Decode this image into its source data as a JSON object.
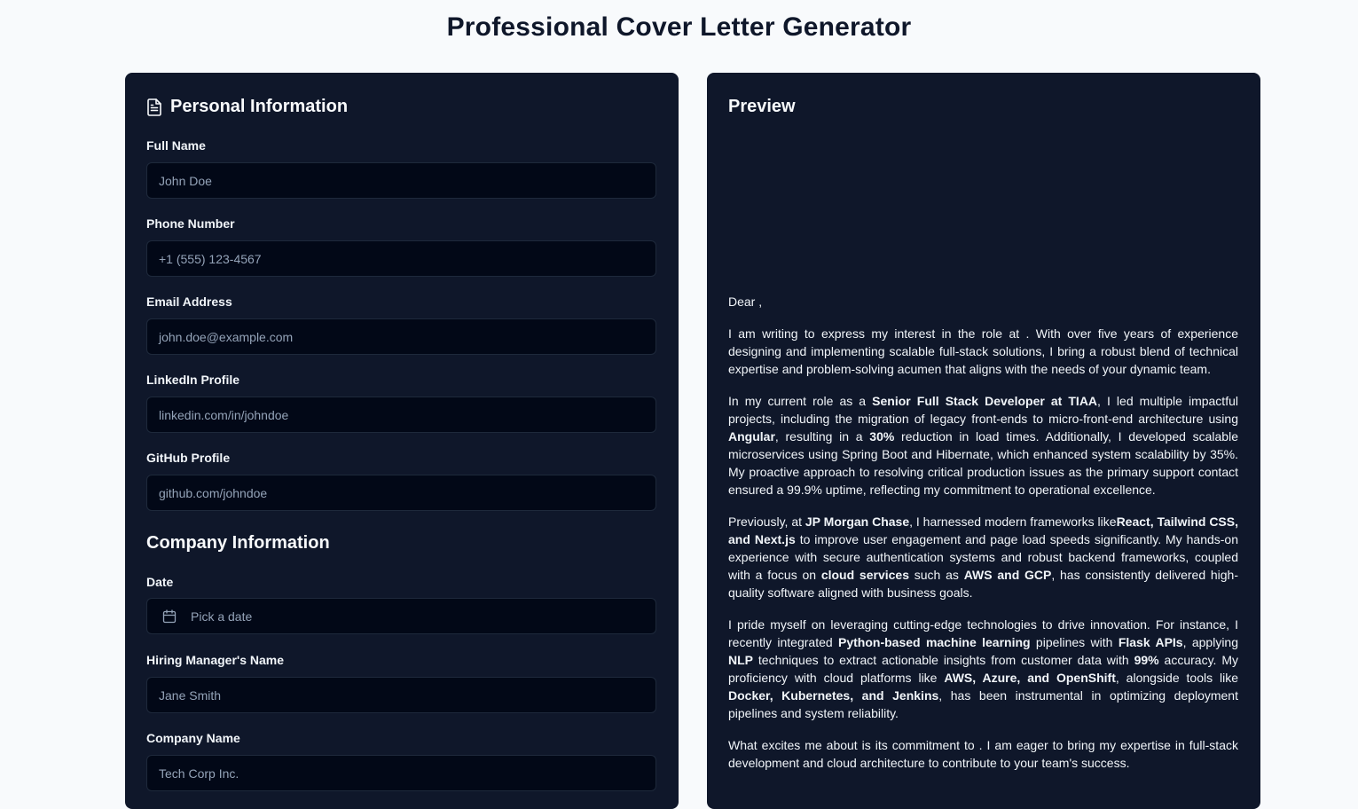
{
  "page": {
    "title": "Professional Cover Letter Generator"
  },
  "personal": {
    "title": "Personal Information",
    "full_name": {
      "label": "Full Name",
      "placeholder": "John Doe"
    },
    "phone": {
      "label": "Phone Number",
      "placeholder": "+1 (555) 123-4567"
    },
    "email": {
      "label": "Email Address",
      "placeholder": "john.doe@example.com"
    },
    "linkedin": {
      "label": "LinkedIn Profile",
      "placeholder": "linkedin.com/in/johndoe"
    },
    "github": {
      "label": "GitHub Profile",
      "placeholder": "github.com/johndoe"
    }
  },
  "company": {
    "title": "Company Information",
    "date": {
      "label": "Date",
      "placeholder": "Pick a date"
    },
    "manager": {
      "label": "Hiring Manager's Name",
      "placeholder": "Jane Smith"
    },
    "company_name": {
      "label": "Company Name",
      "placeholder": "Tech Corp Inc."
    }
  },
  "preview": {
    "title": "Preview",
    "salutation": "Dear ,",
    "p1": "I am writing to express my interest in the role at . With over five years of experience designing and implementing scalable full-stack solutions, I bring a robust blend of technical expertise and problem-solving acumen that aligns with the needs of your dynamic team.",
    "p2": {
      "t1": "In my current role as a ",
      "b1": "Senior Full Stack Developer at TIAA",
      "t2": ", I led multiple impactful projects, including the migration of legacy front-ends to micro-front-end architecture using ",
      "b2": "Angular",
      "t3": ", resulting in a ",
      "b3": "30%",
      "t4": " reduction in load times. Additionally, I developed scalable microservices using Spring Boot and Hibernate, which enhanced system scalability by 35%. My proactive approach to resolving critical production issues as the primary support contact ensured a 99.9% uptime, reflecting my commitment to operational excellence."
    },
    "p3": {
      "t1": "Previously, at ",
      "b1": "JP Morgan Chase",
      "t2": ", I harnessed modern frameworks like",
      "b2": "React, Tailwind CSS, and Next.js",
      "t3": " to improve user engagement and page load speeds significantly. My hands-on experience with secure authentication systems and robust backend frameworks, coupled with a focus on ",
      "b3": "cloud services",
      "t4": " such as ",
      "b4": "AWS and GCP",
      "t5": ", has consistently delivered high-quality software aligned with business goals."
    },
    "p4": {
      "t1": "I pride myself on leveraging cutting-edge technologies to drive innovation. For instance, I recently integrated ",
      "b1": "Python-based machine learning",
      "t2": " pipelines with ",
      "b2": "Flask APIs",
      "t3": ", applying ",
      "b3": "NLP",
      "t4": " techniques to extract actionable insights from customer data with ",
      "b4": "99%",
      "t5": " accuracy. My proficiency with cloud platforms like ",
      "b5": "AWS, Azure, and OpenShift",
      "t6": ", alongside tools like ",
      "b6": "Docker, Kubernetes, and Jenkins",
      "t7": ", has been instrumental in optimizing deployment pipelines and system reliability."
    },
    "p5": "What excites me about is its commitment to . I am eager to bring my expertise in full-stack development and cloud architecture to contribute to your team's success."
  },
  "icons": {
    "section": "document-icon",
    "date": "calendar-icon"
  },
  "colors": {
    "background": "#f8fafc",
    "panel": "#0f172a",
    "input": "#020817",
    "input_border": "#1e293b",
    "placeholder": "#94a3b8",
    "text": "#f1f5f9"
  }
}
